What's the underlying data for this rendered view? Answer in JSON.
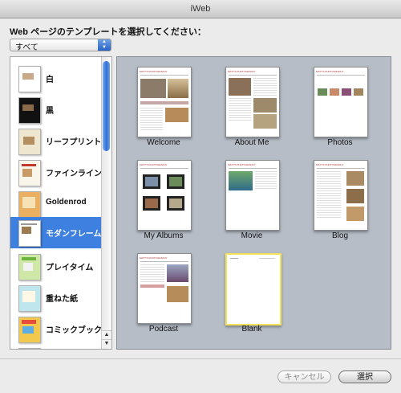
{
  "window": {
    "title": "iWeb"
  },
  "prompt": "Web ページのテンプレートを選択してください：",
  "category_popup": {
    "selected": "すべて"
  },
  "sidebar": {
    "items": [
      {
        "label": "白",
        "icon": "white-theme-thumbnail"
      },
      {
        "label": "黒",
        "icon": "black-theme-thumbnail"
      },
      {
        "label": "リーフプリント",
        "icon": "leaf-print-theme-thumbnail"
      },
      {
        "label": "ファインライン",
        "icon": "fine-line-theme-thumbnail"
      },
      {
        "label": "Goldenrod",
        "icon": "goldenrod-theme-thumbnail"
      },
      {
        "label": "モダンフレーム",
        "icon": "modern-frame-theme-thumbnail",
        "selected": true
      },
      {
        "label": "プレイタイム",
        "icon": "playtime-theme-thumbnail"
      },
      {
        "label": "重ねた紙",
        "icon": "layered-paper-theme-thumbnail"
      },
      {
        "label": "コミックブック",
        "icon": "comic-book-theme-thumbnail"
      }
    ]
  },
  "templates": [
    {
      "label": "Welcome",
      "header": "MATT'S PHOTOGRAPHY"
    },
    {
      "label": "About Me",
      "header": "MATT'S PHOTOGRAPHY"
    },
    {
      "label": "Photos",
      "header": "MATT'S PHOTOGRAPHY"
    },
    {
      "label": "My Albums",
      "header": "MATT'S PHOTOGRAPHY"
    },
    {
      "label": "Movie",
      "header": "MATT'S PHOTOGRAPHY"
    },
    {
      "label": "Blog",
      "header": "MATT'S PHOTOGRAPHY"
    },
    {
      "label": "Podcast",
      "header": "MATT'S PHOTOGRAPHY"
    },
    {
      "label": "Blank",
      "selected": true
    }
  ],
  "buttons": {
    "cancel": "キャンセル",
    "select": "選択"
  },
  "colors": {
    "selection": "#3d80df",
    "blank_highlight": "#f2e35a",
    "grid_background": "#b6bdc7"
  }
}
